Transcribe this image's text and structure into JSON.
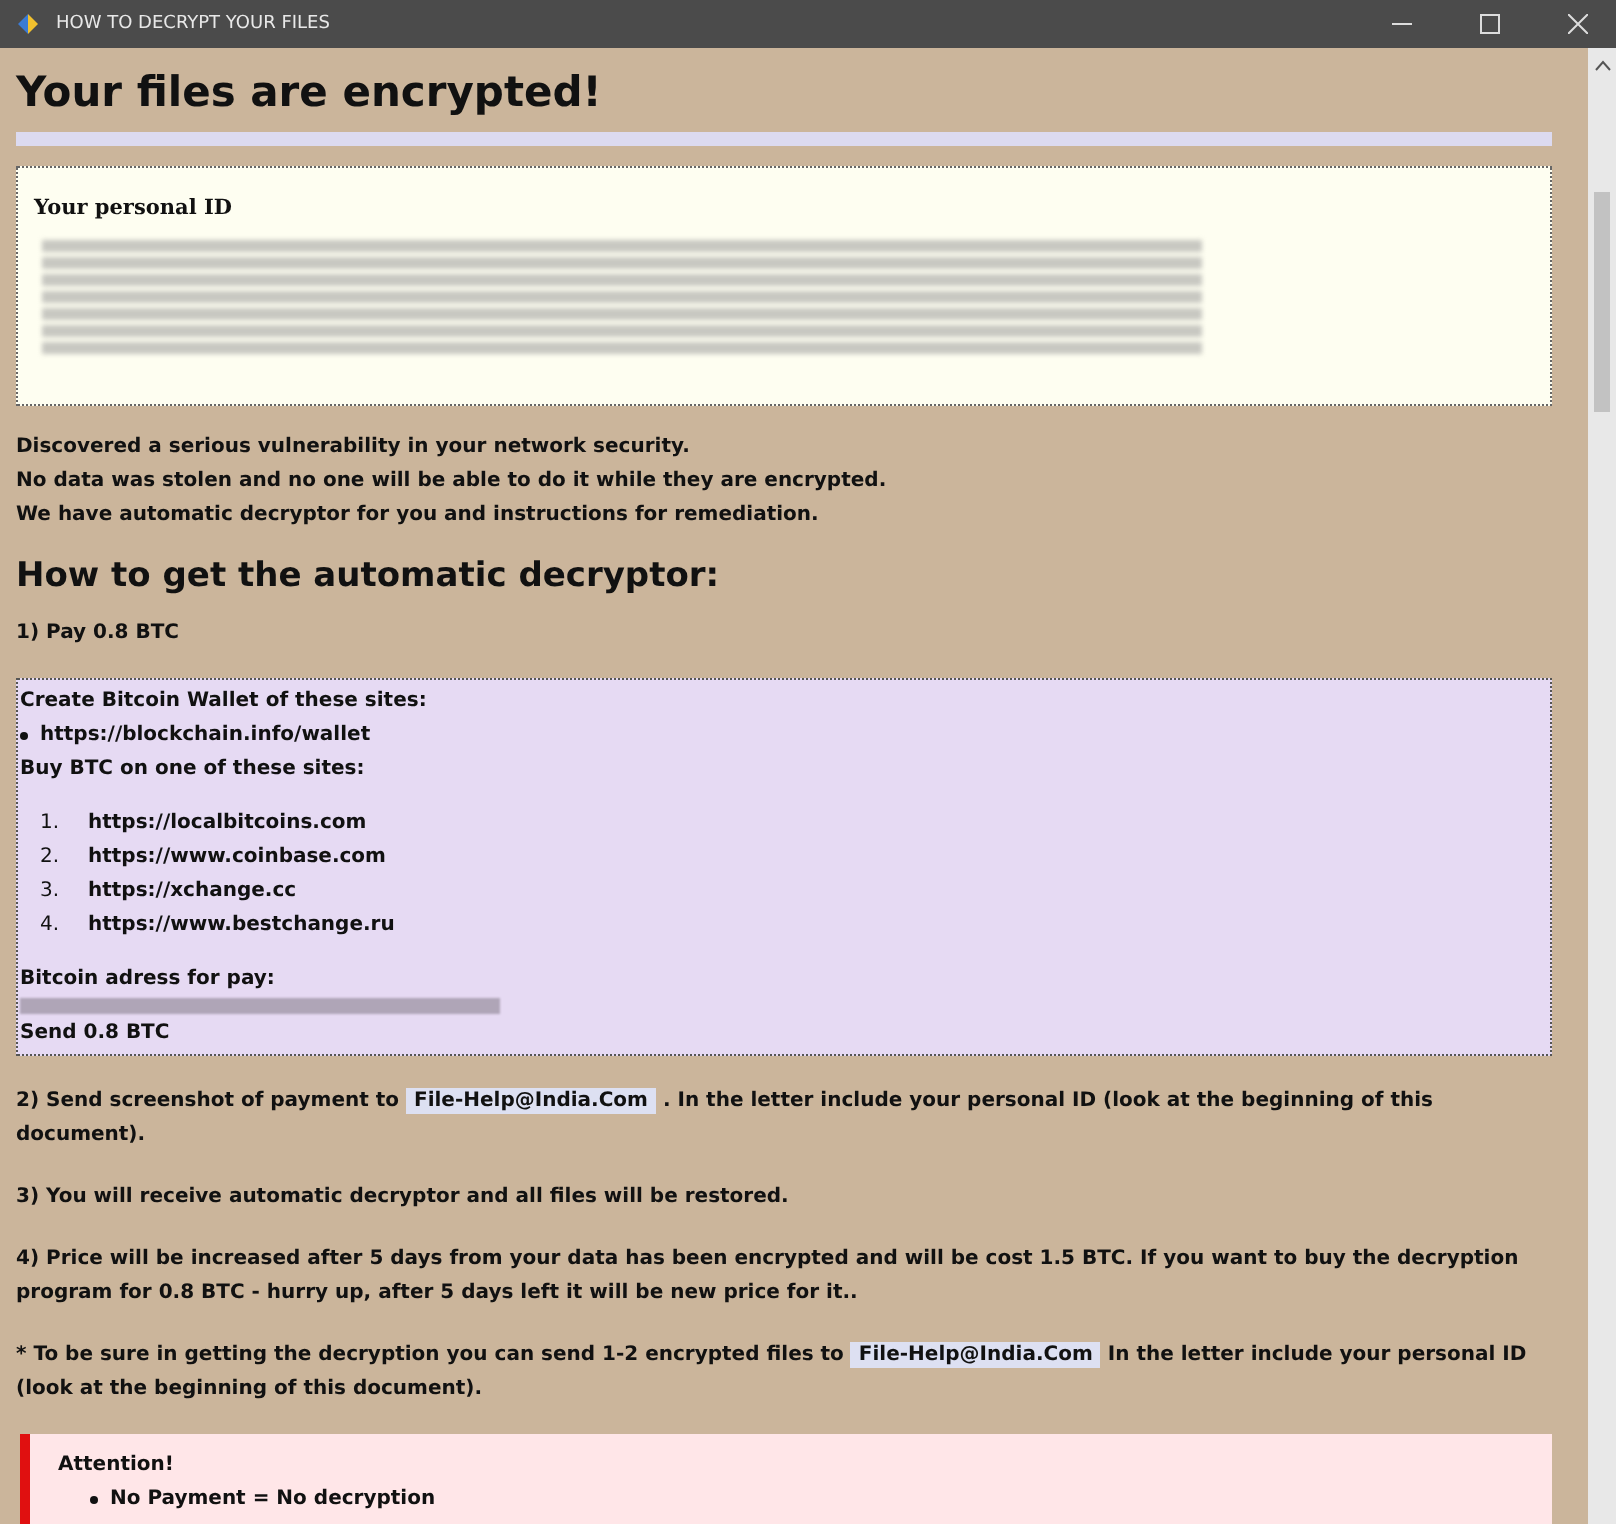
{
  "window": {
    "title": "HOW TO DECRYPT YOUR FILES"
  },
  "heading": "Your files are encrypted!",
  "id_box": {
    "label": "Your personal ID"
  },
  "intro": [
    "Discovered a serious vulnerability in your network security.",
    "No data was stolen and no one will be able to do it while they are encrypted.",
    "We have automatic decryptor for you and instructions for remediation."
  ],
  "subheading": "How to get the automatic decryptor:",
  "step1": "1) Pay 0.8 BTC",
  "payment_box": {
    "wallet_title": "Create Bitcoin Wallet of these sites:",
    "wallet_sites": [
      "https://blockchain.info/wallet"
    ],
    "buy_title": "Buy BTC on one of these sites:",
    "buy_sites": [
      {
        "number": "1.",
        "url": "https://localbitcoins.com"
      },
      {
        "number": "2.",
        "url": "https://www.coinbase.com"
      },
      {
        "number": "3.",
        "url": "https://xchange.cc"
      },
      {
        "number": "4.",
        "url": "https://www.bestchange.ru"
      }
    ],
    "address_label": "Bitcoin adress for pay:",
    "send": "Send 0.8 BTC"
  },
  "step2": {
    "before": "2) Send screenshot of payment to",
    "email": "File-Help@India.Com",
    "after": ". In the letter include your personal ID (look at the beginning of this document)."
  },
  "step3": "3) You will receive automatic decryptor and all files will be restored.",
  "step4": "4) Price will be increased after 5 days from your data has been encrypted and will be cost 1.5 BTC. If you want to buy the decryption program for 0.8 BTC - hurry up, after 5 days left it will be new price for it..",
  "note": {
    "before": "* To be sure in getting the decryption you can send 1-2 encrypted files to",
    "email": "File-Help@India.Com",
    "after": "In the letter include your personal ID (look at the beginning of this document)."
  },
  "attention": {
    "title": "Attention!",
    "items": [
      "No Payment = No decryption"
    ]
  }
}
